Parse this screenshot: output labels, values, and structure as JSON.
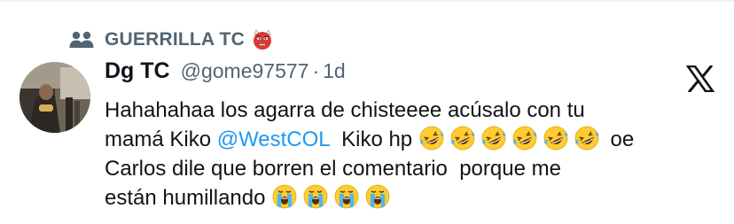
{
  "community": {
    "icon": "community-people-icon",
    "name": "GUERRILLA TC",
    "emoji": "ogre-emoji"
  },
  "tweet": {
    "display_name": "Dg TC",
    "handle": "@gome97577",
    "separator": "·",
    "time": "1d",
    "line1": "Hahahahaa los agarra de chisteeee acúsalo con tu",
    "line2_prefix": "mamá Kiko ",
    "mention": "@WestCOL",
    "line2_middle": "  Kiko hp ",
    "laughing_emoji_count": 6,
    "line2_suffix": " oe",
    "line3": "Carlos dile que borren el comentario  porque me",
    "line4_text": "están humillando ",
    "crying_emoji_count": 4
  },
  "icons": {
    "platform_logo": "x-logo-icon",
    "laughing": "rolling-on-floor-laughing-icon",
    "crying": "loudly-crying-face-icon"
  },
  "colors": {
    "text": "#0f1419",
    "muted": "#536471",
    "link": "#1d9bf0"
  }
}
